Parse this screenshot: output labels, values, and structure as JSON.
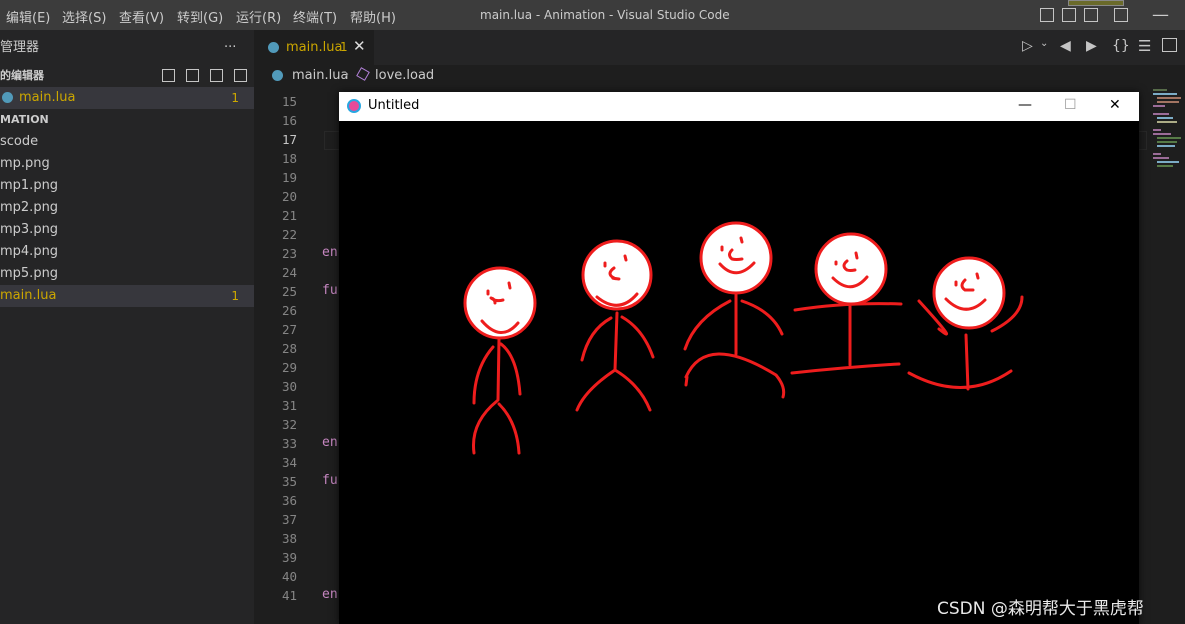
{
  "menu": [
    "编辑(E)",
    "选择(S)",
    "查看(V)",
    "转到(G)",
    "运行(R)",
    "终端(T)",
    "帮助(H)"
  ],
  "window_title": "main.lua - Animation - Visual Studio Code",
  "sidebar": {
    "explorer_title": "管理器",
    "open_editors_title": "的编辑器",
    "open_editor_file": "main.lua",
    "open_editor_badge": "1",
    "project_title": "MATION",
    "files": [
      {
        "label": "scode",
        "badge": ""
      },
      {
        "label": "mp.png",
        "badge": ""
      },
      {
        "label": "mp1.png",
        "badge": ""
      },
      {
        "label": "mp2.png",
        "badge": ""
      },
      {
        "label": "mp3.png",
        "badge": ""
      },
      {
        "label": "mp4.png",
        "badge": ""
      },
      {
        "label": "mp5.png",
        "badge": ""
      },
      {
        "label": "main.lua",
        "badge": "1"
      }
    ]
  },
  "tab": {
    "label": "main.lua",
    "problems": "1",
    "close": "✕"
  },
  "breadcrumb": {
    "file": "main.lua",
    "symbol": "love.load"
  },
  "editor": {
    "line_numbers": [
      "15",
      "16",
      "17",
      "18",
      "19",
      "20",
      "21",
      "22",
      "23",
      "24",
      "25",
      "26",
      "27",
      "28",
      "29",
      "30",
      "31",
      "32",
      "33",
      "34",
      "35",
      "36",
      "37",
      "38",
      "39",
      "40",
      "41"
    ],
    "current_line": "17",
    "keyword_lines": [
      {
        "line": "23",
        "text": "en"
      },
      {
        "line": "25",
        "text": "fu"
      },
      {
        "line": "33",
        "text": "en"
      },
      {
        "line": "35",
        "text": "fu"
      },
      {
        "line": "41",
        "text": "en"
      }
    ]
  },
  "love_window": {
    "title": "Untitled",
    "minimize": "—",
    "maximize": "☐",
    "close": "✕",
    "figure_color": "#ee1d1d"
  },
  "watermark": "CSDN @森明帮大于黑虎帮",
  "colors": {
    "accent_warning": "#cca700",
    "keyword": "#c586c0"
  }
}
